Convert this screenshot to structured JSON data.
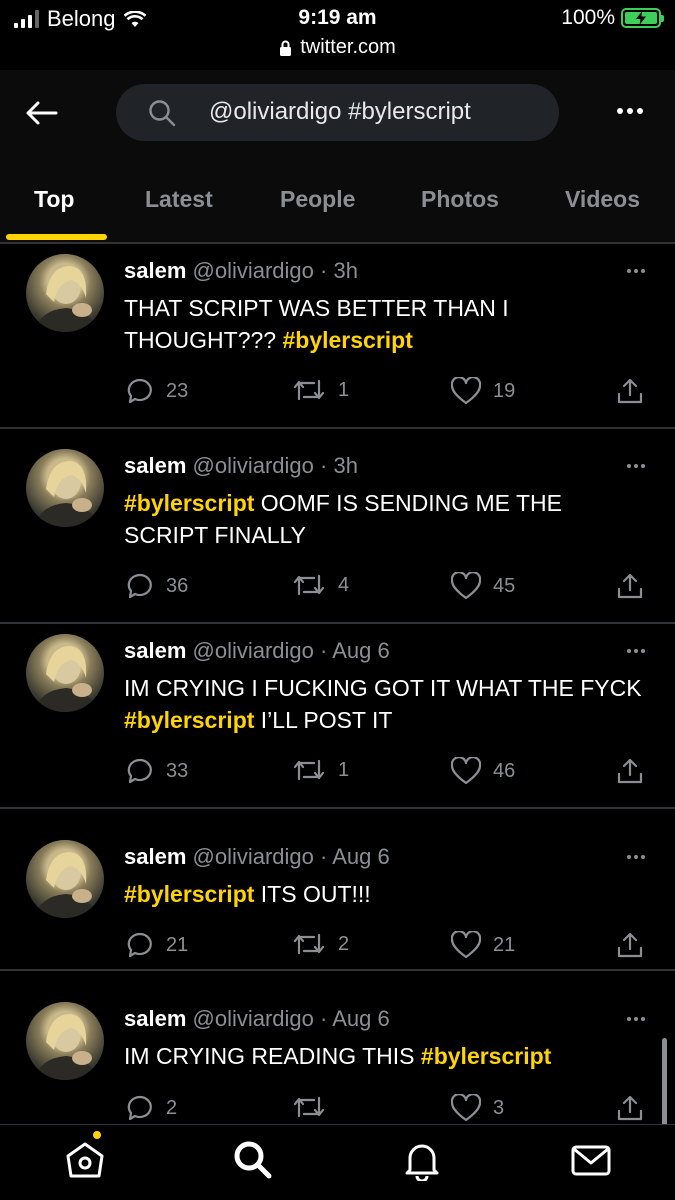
{
  "status_bar": {
    "carrier": "Belong",
    "time": "9:19 am",
    "url": "twitter.com",
    "battery": "100%",
    "battery_color": "#3cd05a"
  },
  "header": {
    "search_query": "@oliviardigo #bylerscript",
    "icons": {
      "back": "arrow-left-icon",
      "search": "search-icon",
      "more": "more-dots-icon"
    }
  },
  "tabs": [
    {
      "label": "Top",
      "active": true
    },
    {
      "label": "Latest",
      "active": false
    },
    {
      "label": "People",
      "active": false
    },
    {
      "label": "Photos",
      "active": false
    },
    {
      "label": "Videos",
      "active": false
    }
  ],
  "accent_color": "#ffd400",
  "tweets": [
    {
      "name": "salem",
      "handle": "@oliviardigo",
      "time": "3h",
      "text_before": "THAT SCRIPT WAS BETTER THAN I THOUGHT??? ",
      "hashtag": "#bylerscript",
      "text_after": "",
      "replies": "23",
      "retweets": "1",
      "likes": "19"
    },
    {
      "name": "salem",
      "handle": "@oliviardigo",
      "time": "3h",
      "text_before": "",
      "hashtag": "#bylerscript",
      "text_after": " OOMF IS SENDING ME THE SCRIPT FINALLY",
      "replies": "36",
      "retweets": "4",
      "likes": "45"
    },
    {
      "name": "salem",
      "handle": "@oliviardigo",
      "time": "Aug 6",
      "text_before": "IM CRYING I FUCKING GOT IT WHAT THE FYCK ",
      "hashtag": "#bylerscript",
      "text_after": " I’LL POST IT",
      "replies": "33",
      "retweets": "1",
      "likes": "46"
    },
    {
      "name": "salem",
      "handle": "@oliviardigo",
      "time": "Aug 6",
      "text_before": "",
      "hashtag": "#bylerscript",
      "text_after": " ITS OUT!!!",
      "replies": "21",
      "retweets": "2",
      "likes": "21"
    },
    {
      "name": "salem",
      "handle": "@oliviardigo",
      "time": "Aug 6",
      "text_before": "IM CRYING READING THIS ",
      "hashtag": "#bylerscript",
      "text_after": "",
      "replies": "2",
      "retweets": "",
      "likes": "3"
    }
  ],
  "bottom_nav": [
    "home-icon",
    "explore-search-icon",
    "notifications-bell-icon",
    "messages-envelope-icon"
  ]
}
